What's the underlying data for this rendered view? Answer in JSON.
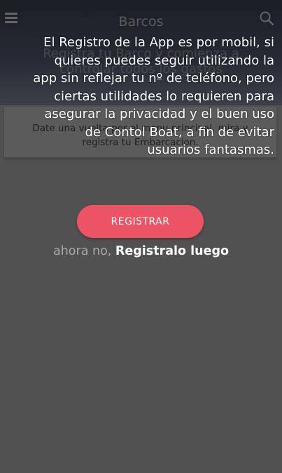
{
  "header": {
    "title": "Barcos",
    "menu_icon": "menu-icon",
    "search_icon": "search-icon"
  },
  "hero": {
    "text": "Registra tu Barco y comienza a controlar todos los gastos"
  },
  "card": {
    "text_line1": "Date una vuelta por el menu principal, mira y",
    "text_line2": "registra tu Embarcacion."
  },
  "cta": {
    "register_label": "REGISTRAR",
    "later_prefix": "ahora no, ",
    "later_link": "Registralo luego"
  },
  "tooltip": {
    "text": "El Registro de la App es por mobil, si quieres puedes seguir utilizando la app sin reflejar tu nº de teléfono, pero ciertas utilidades lo requieren para asegurar la privacidad y el buen uso de Contol Boat, a fin de evitar usuarios fantasmas."
  },
  "colors": {
    "overlay": "#515151",
    "accent": "#ec5465",
    "text_light": "#ffffff"
  }
}
